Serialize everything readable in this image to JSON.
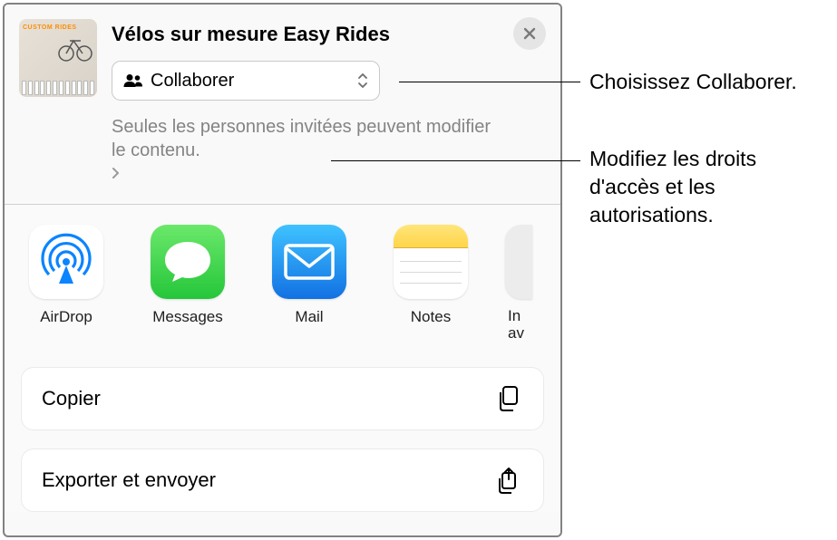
{
  "document": {
    "title": "Vélos sur mesure Easy Rides",
    "thumb_text": "CUSTOM\nRIDES"
  },
  "share_mode": {
    "label": "Collaborer"
  },
  "permissions": {
    "text": "Seules les personnes invitées peuvent modifier le contenu."
  },
  "apps": [
    {
      "id": "airdrop",
      "label": "AirDrop"
    },
    {
      "id": "messages",
      "label": "Messages"
    },
    {
      "id": "mail",
      "label": "Mail"
    },
    {
      "id": "notes",
      "label": "Notes"
    },
    {
      "id": "more",
      "label": "In\nav"
    }
  ],
  "actions": {
    "copy": "Copier",
    "export": "Exporter et envoyer"
  },
  "callouts": {
    "choose": "Choisissez Collaborer.",
    "modify": "Modifiez les droits d'accès et les autorisations."
  }
}
